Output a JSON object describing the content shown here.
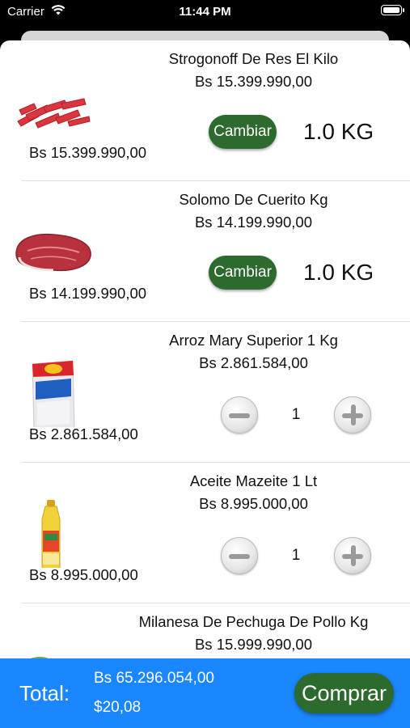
{
  "status_bar": {
    "carrier": "Carrier",
    "time": "11:44 PM"
  },
  "cart": {
    "items": [
      {
        "name": "Strogonoff De Res El Kilo",
        "price": "Bs 15.399.990,00",
        "subtotal": "Bs 15.399.990,00",
        "action_label": "Cambiar",
        "quantity": "1.0 KG",
        "image": "beef-strips"
      },
      {
        "name": "Solomo De Cuerito Kg",
        "price": "Bs 14.199.990,00",
        "subtotal": "Bs 14.199.990,00",
        "action_label": "Cambiar",
        "quantity": "1.0 KG",
        "image": "beef-cut"
      },
      {
        "name": "Arroz Mary Superior 1 Kg",
        "price": "Bs 2.861.584,00",
        "subtotal": "Bs 2.861.584,00",
        "quantity": "1",
        "image": "rice-bag"
      },
      {
        "name": "Aceite Mazeite 1 Lt",
        "price": "Bs 8.995.000,00",
        "subtotal": "Bs 8.995.000,00",
        "quantity": "1",
        "image": "oil-bottle"
      },
      {
        "name": "Milanesa De Pechuga De Pollo Kg",
        "price": "Bs 15.999.990,00",
        "image": "chicken-breast"
      }
    ]
  },
  "footer": {
    "label": "Total:",
    "total_bs": "Bs 65.296.054,00",
    "total_usd": "$20,08",
    "buy_label": "Comprar"
  },
  "colors": {
    "footer_bg": "#1a86ff",
    "button_green": "#2c6a2e"
  }
}
